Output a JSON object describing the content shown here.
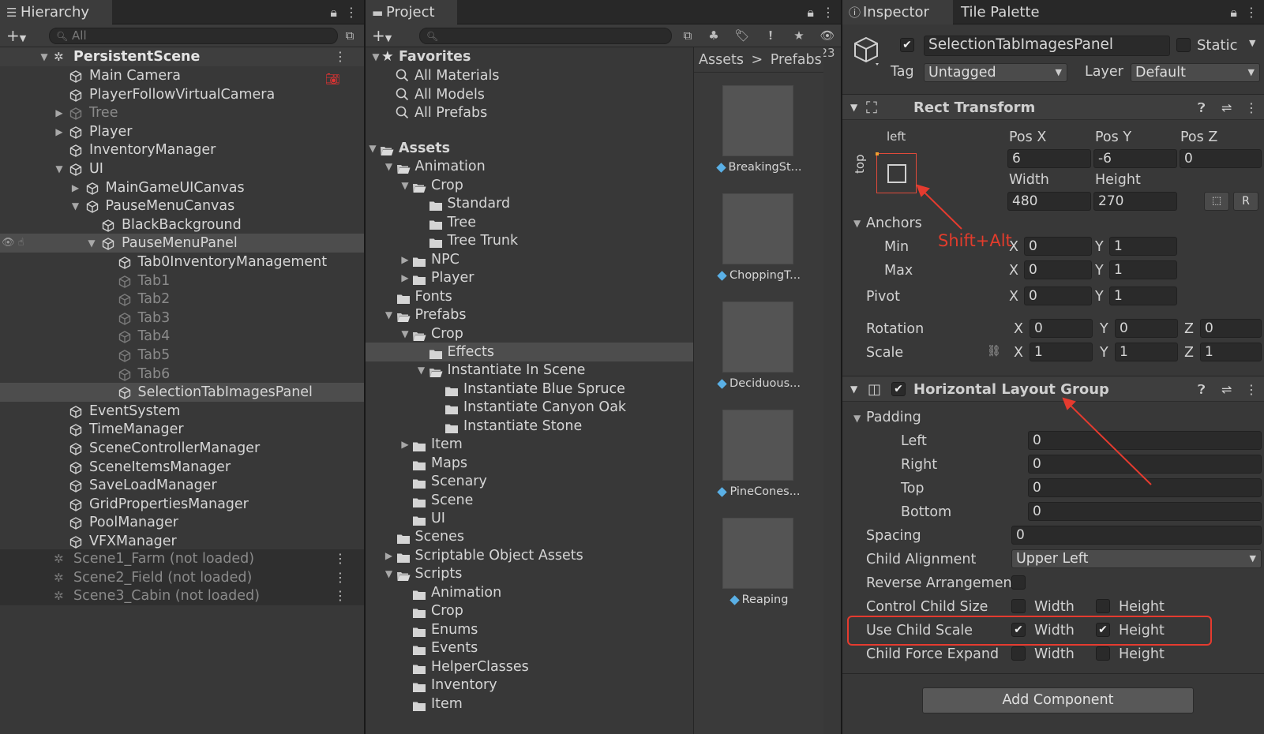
{
  "hierarchy": {
    "tab_label": "Hierarchy",
    "search_placeholder": "All",
    "scene": "PersistentScene",
    "items": [
      {
        "label": "Main Camera"
      },
      {
        "label": "PlayerFollowVirtualCamera"
      },
      {
        "label": "Tree"
      },
      {
        "label": "Player"
      },
      {
        "label": "InventoryManager"
      },
      {
        "label": "UI"
      },
      {
        "label": "MainGameUICanvas"
      },
      {
        "label": "PauseMenuCanvas"
      },
      {
        "label": "BlackBackground"
      },
      {
        "label": "PauseMenuPanel"
      },
      {
        "label": "Tab0InventoryManagement"
      },
      {
        "label": "Tab1"
      },
      {
        "label": "Tab2"
      },
      {
        "label": "Tab3"
      },
      {
        "label": "Tab4"
      },
      {
        "label": "Tab5"
      },
      {
        "label": "Tab6"
      },
      {
        "label": "SelectionTabImagesPanel"
      },
      {
        "label": "EventSystem"
      },
      {
        "label": "TimeManager"
      },
      {
        "label": "SceneControllerManager"
      },
      {
        "label": "SceneItemsManager"
      },
      {
        "label": "SaveLoadManager"
      },
      {
        "label": "GridPropertiesManager"
      },
      {
        "label": "PoolManager"
      },
      {
        "label": "VFXManager"
      }
    ],
    "unloaded_scenes": [
      "Scene1_Farm (not loaded)",
      "Scene2_Field (not loaded)",
      "Scene3_Cabin (not loaded)"
    ]
  },
  "project": {
    "tab_label": "Project",
    "visible_count": "23",
    "favorites_label": "Favorites",
    "favorites": [
      "All Materials",
      "All Models",
      "All Prefabs"
    ],
    "tree": [
      {
        "label": "Assets"
      },
      {
        "label": "Animation"
      },
      {
        "label": "Crop"
      },
      {
        "label": "Standard"
      },
      {
        "label": "Tree"
      },
      {
        "label": "Tree Trunk"
      },
      {
        "label": "NPC"
      },
      {
        "label": "Player"
      },
      {
        "label": "Fonts"
      },
      {
        "label": "Prefabs"
      },
      {
        "label": "Crop"
      },
      {
        "label": "Effects"
      },
      {
        "label": "Instantiate In Scene"
      },
      {
        "label": "Instantiate Blue Spruce"
      },
      {
        "label": "Instantiate Canyon Oak"
      },
      {
        "label": "Instantiate Stone"
      },
      {
        "label": "Item"
      },
      {
        "label": "Maps"
      },
      {
        "label": "Scenary"
      },
      {
        "label": "Scene"
      },
      {
        "label": "UI"
      },
      {
        "label": "Scenes"
      },
      {
        "label": "Scriptable Object Assets"
      },
      {
        "label": "Scripts"
      },
      {
        "label": "Animation"
      },
      {
        "label": "Crop"
      },
      {
        "label": "Enums"
      },
      {
        "label": "Events"
      },
      {
        "label": "HelperClasses"
      },
      {
        "label": "Inventory"
      },
      {
        "label": "Item"
      }
    ],
    "breadcrumb": [
      "Assets",
      "Prefabs"
    ],
    "breadcrumb_sep": ">",
    "assets": [
      "BreakingSt...",
      "ChoppingT...",
      "Deciduous...",
      "PineCones...",
      "Reaping"
    ]
  },
  "inspector": {
    "tab_label": "Inspector",
    "tab2_label": "Tile Palette",
    "object_name": "SelectionTabImagesPanel",
    "static_label": "Static",
    "tag_label": "Tag",
    "tag_value": "Untagged",
    "layer_label": "Layer",
    "layer_value": "Default",
    "rect": {
      "title": "Rect Transform",
      "anchor_h": "left",
      "anchor_v": "top",
      "posx_label": "Pos X",
      "posy_label": "Pos Y",
      "posz_label": "Pos Z",
      "posx": "6",
      "posy": "-6",
      "posz": "0",
      "width_label": "Width",
      "height_label": "Height",
      "width": "480",
      "height": "270",
      "r_label": "R",
      "anchors_label": "Anchors",
      "min_label": "Min",
      "max_label": "Max",
      "pivot_label": "Pivot",
      "x": "X",
      "y": "Y",
      "z": "Z",
      "min_x": "0",
      "min_y": "1",
      "max_x": "0",
      "max_y": "1",
      "pivot_x": "0",
      "pivot_y": "1",
      "rotation_label": "Rotation",
      "scale_label": "Scale",
      "rot_x": "0",
      "rot_y": "0",
      "rot_z": "0",
      "scale_x": "1",
      "scale_y": "1",
      "scale_z": "1"
    },
    "hlg": {
      "title": "Horizontal Layout Group",
      "padding_label": "Padding",
      "left_label": "Left",
      "right_label": "Right",
      "top_label": "Top",
      "bottom_label": "Bottom",
      "left": "0",
      "right": "0",
      "top": "0",
      "bottom": "0",
      "spacing_label": "Spacing",
      "spacing": "0",
      "child_alignment_label": "Child Alignment",
      "child_alignment": "Upper Left",
      "reverse_label": "Reverse Arrangemen",
      "control_label": "Control Child Size",
      "use_scale_label": "Use Child Scale",
      "force_expand_label": "Child Force Expand",
      "width_label": "Width",
      "height_label": "Height"
    },
    "add_component": "Add Component",
    "annotation": "Shift+Alt"
  },
  "colors": {
    "annotation": "#e53b2f",
    "selected_row": "#4d4d4d",
    "panel": "#383838"
  }
}
